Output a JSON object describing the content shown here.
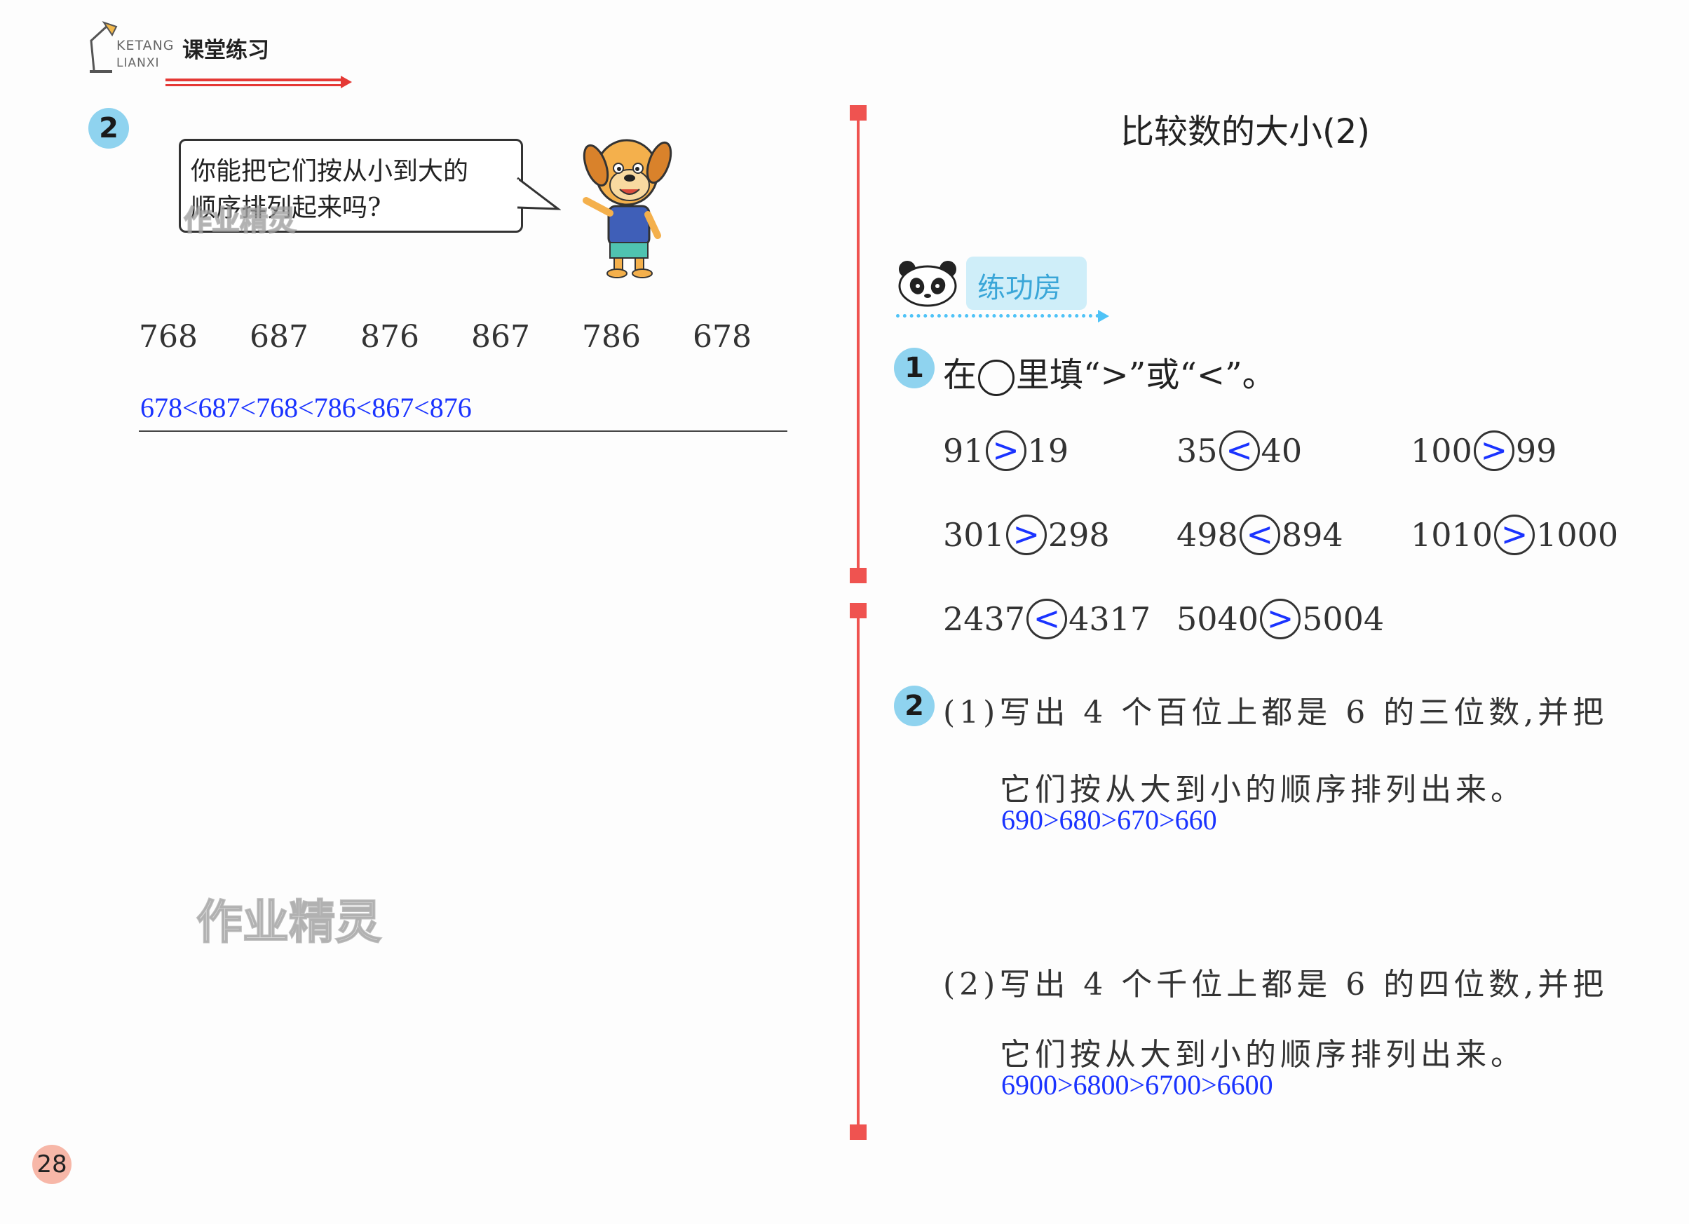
{
  "header": {
    "logo_en_1": "KETANG",
    "logo_en_2": "LIANXI",
    "logo_cn": "课堂练习"
  },
  "left": {
    "q2_badge": "2",
    "bubble_line1": "你能把它们按从小到大的",
    "bubble_line2": "顺序排列起来吗?",
    "numbers": [
      "768",
      "687",
      "876",
      "867",
      "786",
      "678"
    ],
    "answer": "678<687<768<786<867<876",
    "watermark_small": "作业精灵",
    "watermark_large": "作业精灵",
    "page_number": "28"
  },
  "right": {
    "title": "比较数的大小(2)",
    "section_label": "练功房",
    "q1_badge": "1",
    "q1_text_pre": "在",
    "q1_text_post": "里填“>”或“<”。",
    "comparisons": [
      {
        "a": "91",
        "sign": ">",
        "b": "19"
      },
      {
        "a": "35",
        "sign": "<",
        "b": "40"
      },
      {
        "a": "100",
        "sign": ">",
        "b": "99"
      },
      {
        "a": "301",
        "sign": ">",
        "b": "298"
      },
      {
        "a": "498",
        "sign": "<",
        "b": "894"
      },
      {
        "a": "1010",
        "sign": ">",
        "b": "1000"
      },
      {
        "a": "2437",
        "sign": "<",
        "b": "4317"
      },
      {
        "a": "5040",
        "sign": ">",
        "b": "5004"
      }
    ],
    "q2_badge": "2",
    "q2_1_line1": "(1)写出 4 个百位上都是 6 的三位数,并把",
    "q2_1_line2": "它们按从大到小的顺序排列出来。",
    "q2_1_answer": "690>680>670>660",
    "q2_2_line1": "(2)写出 4 个千位上都是 6 的四位数,并把",
    "q2_2_line2": "它们按从大到小的顺序排列出来。",
    "q2_2_answer": "6900>6800>6700>6600"
  },
  "colors": {
    "accent_red": "#ef5350",
    "badge_blue": "#8fd3ef",
    "answer_blue": "#1a33ff",
    "page_badge": "#f7b7a8"
  }
}
